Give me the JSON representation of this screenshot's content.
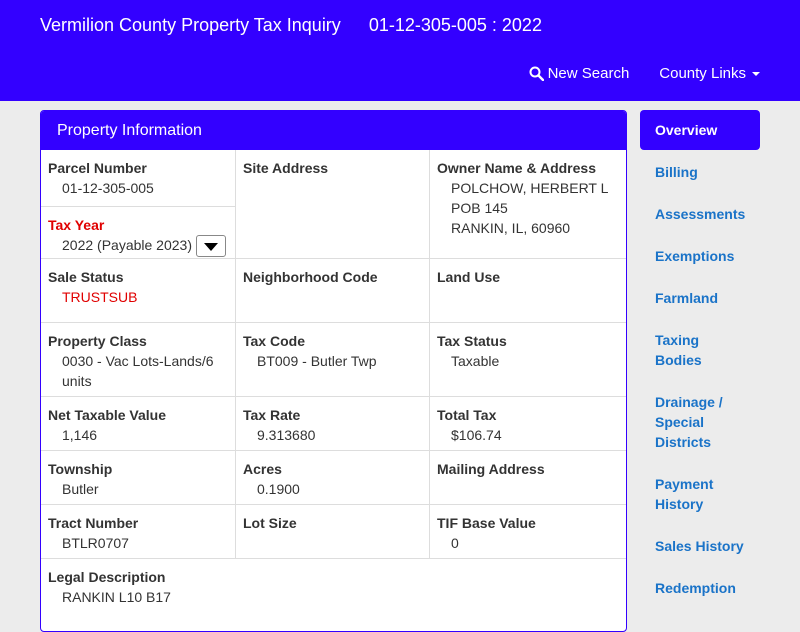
{
  "header": {
    "app_title": "Vermilion County Property Tax Inquiry",
    "parcel_title": "01-12-305-005 : 2022",
    "new_search_label": "New Search",
    "county_links_label": "County Links"
  },
  "panel": {
    "title": "Property Information",
    "parcel_number_label": "Parcel Number",
    "parcel_number": "01-12-305-005",
    "tax_year_label": "Tax Year",
    "tax_year_value": "2022 (Payable 2023)",
    "site_address_label": "Site Address",
    "site_address": "",
    "owner_label": "Owner Name & Address",
    "owner_line1": "POLCHOW, HERBERT L",
    "owner_line2": "POB 145",
    "owner_line3": "RANKIN, IL, 60960",
    "sale_status_label": "Sale Status",
    "sale_status": "TRUSTSUB",
    "neighborhood_label": "Neighborhood Code",
    "neighborhood": "",
    "land_use_label": "Land Use",
    "land_use": "",
    "property_class_label": "Property Class",
    "property_class": "0030 - Vac Lots-Lands/6 units",
    "tax_code_label": "Tax Code",
    "tax_code": "BT009 - Butler Twp",
    "tax_status_label": "Tax Status",
    "tax_status": "Taxable",
    "net_taxable_label": "Net Taxable Value",
    "net_taxable": "1,146",
    "tax_rate_label": "Tax Rate",
    "tax_rate": "9.313680",
    "total_tax_label": "Total Tax",
    "total_tax": "$106.74",
    "township_label": "Township",
    "township": "Butler",
    "acres_label": "Acres",
    "acres": "0.1900",
    "mailing_label": "Mailing Address",
    "mailing": "",
    "tract_label": "Tract Number",
    "tract": "BTLR0707",
    "lot_size_label": "Lot Size",
    "lot_size": "",
    "tif_label": "TIF Base Value",
    "tif": "0",
    "legal_label": "Legal Description",
    "legal": "RANKIN L10 B17"
  },
  "sidebar": {
    "items": [
      {
        "label": "Overview"
      },
      {
        "label": "Billing"
      },
      {
        "label": "Assessments"
      },
      {
        "label": "Exemptions"
      },
      {
        "label": "Farmland"
      },
      {
        "label": "Taxing Bodies"
      },
      {
        "label": "Drainage / Special Districts"
      },
      {
        "label": "Payment History"
      },
      {
        "label": "Sales History"
      },
      {
        "label": "Redemption"
      }
    ]
  },
  "colors": {
    "brand": "#3300ff",
    "link": "#1a73c8",
    "alert": "#e00000"
  }
}
